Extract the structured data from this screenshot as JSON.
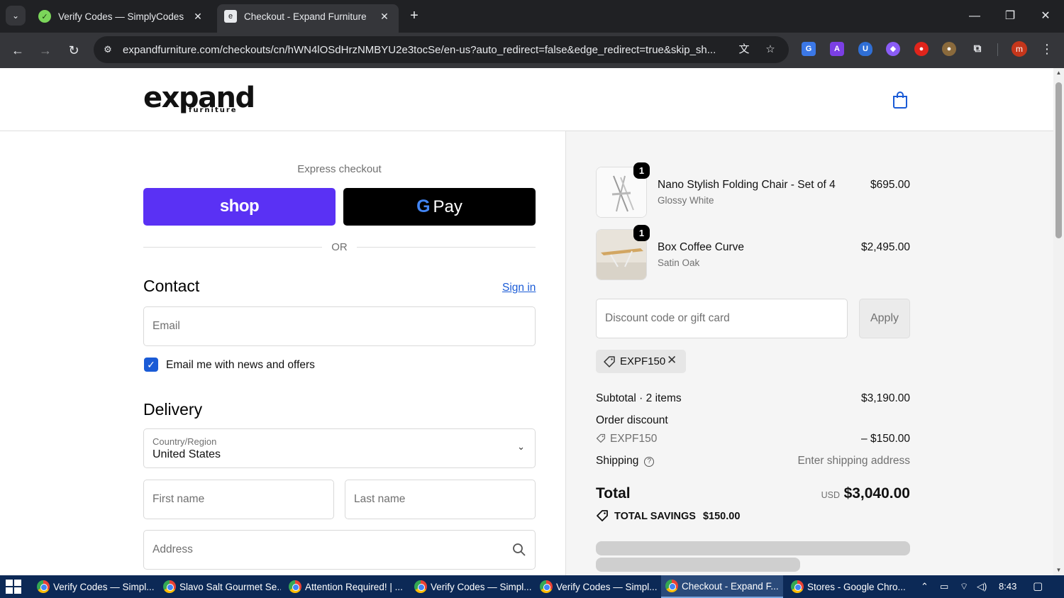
{
  "browser": {
    "tabs": [
      {
        "title": "Verify Codes — SimplyCodes",
        "active": false
      },
      {
        "title": "Checkout - Expand Furniture",
        "active": true
      }
    ],
    "url": "expandfurniture.com/checkouts/cn/hWN4lOSdHrzNMBYU2e3tocSe/en-us?auto_redirect=false&edge_redirect=true&skip_sh...",
    "profile_initial": "m"
  },
  "header": {
    "logo_main": "expand",
    "logo_sub": "furniture"
  },
  "checkout": {
    "express_label": "Express checkout",
    "shop_label": "shop",
    "gpay_g": "G",
    "gpay_label": "Pay",
    "or_label": "OR",
    "contact_heading": "Contact",
    "sign_in": "Sign in",
    "email_placeholder": "Email",
    "news_label": "Email me with news and offers",
    "delivery_heading": "Delivery",
    "country_label": "Country/Region",
    "country_value": "United States",
    "first_name_placeholder": "First name",
    "last_name_placeholder": "Last name",
    "address_placeholder": "Address"
  },
  "summary": {
    "items": [
      {
        "qty": "1",
        "name": "Nano Stylish Folding Chair - Set of 4",
        "variant": "Glossy White",
        "price": "$695.00"
      },
      {
        "qty": "1",
        "name": "Box Coffee Curve",
        "variant": "Satin Oak",
        "price": "$2,495.00"
      }
    ],
    "discount_placeholder": "Discount code or gift card",
    "apply_label": "Apply",
    "applied_code": "EXPF150",
    "subtotal_label": "Subtotal · 2 items",
    "subtotal_value": "$3,190.00",
    "order_discount_label": "Order discount",
    "discount_code": "EXPF150",
    "discount_value": "– $150.00",
    "shipping_label": "Shipping",
    "shipping_value": "Enter shipping address",
    "total_label": "Total",
    "total_currency": "USD",
    "total_value": "$3,040.00",
    "savings_label": "TOTAL SAVINGS",
    "savings_value": "$150.00"
  },
  "taskbar": {
    "items": [
      {
        "label": "Verify Codes — Simpl...",
        "active": false
      },
      {
        "label": "Slavo Salt Gourmet Se...",
        "active": false
      },
      {
        "label": "Attention Required! | ...",
        "active": false
      },
      {
        "label": "Verify Codes — Simpl...",
        "active": false
      },
      {
        "label": "Verify Codes — Simpl...",
        "active": false
      },
      {
        "label": "Checkout - Expand F...",
        "active": true
      },
      {
        "label": "Stores - Google Chro...",
        "active": false
      }
    ],
    "time": "8:43"
  },
  "colors": {
    "shop_purple": "#5a31f4",
    "link_blue": "#1a5bd6",
    "chrome_dark": "#202124"
  }
}
